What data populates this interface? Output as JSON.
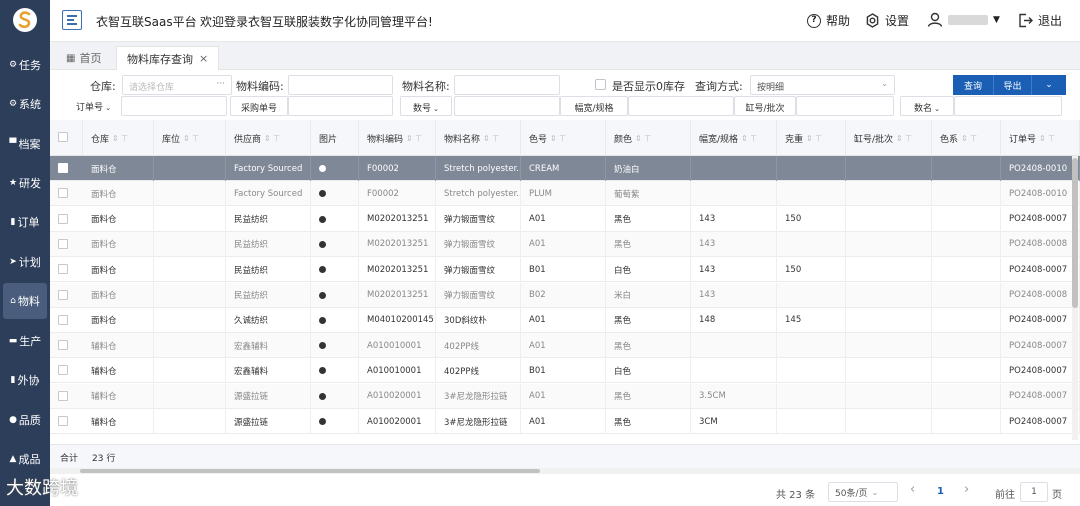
{
  "sidebar": {
    "items": [
      {
        "icon": "⚙",
        "label": "任务"
      },
      {
        "icon": "⚙",
        "label": "系统"
      },
      {
        "icon": "▀",
        "label": "档案"
      },
      {
        "icon": "★",
        "label": "研发"
      },
      {
        "icon": "▮",
        "label": "订单"
      },
      {
        "icon": "➤",
        "label": "计划"
      },
      {
        "icon": "⌂",
        "label": "物料"
      },
      {
        "icon": "▬",
        "label": "生产"
      },
      {
        "icon": "▮",
        "label": "外协"
      },
      {
        "icon": "●",
        "label": "品质"
      },
      {
        "icon": "▲",
        "label": "成品"
      }
    ]
  },
  "header": {
    "app_title": "衣智互联Saas平台",
    "welcome": "欢迎登录衣智互联服装数字化协同管理平台!",
    "help": "帮助",
    "settings": "设置",
    "logout": "退出"
  },
  "tabs": {
    "home": "首页",
    "active": "物料库存查询",
    "close": "×"
  },
  "filters": {
    "warehouse_label": "仓库:",
    "warehouse_placeholder": "请选择仓库",
    "warehouse_more": "···",
    "material_code_label": "物料编码:",
    "material_name_label": "物料名称:",
    "show_zero_label": "是否显示0库存",
    "query_mode_label": "查询方式:",
    "query_mode_value": "按明细",
    "query_button": "查询",
    "export_button": "导出",
    "order_no": "订单号",
    "purchase_no": "采购单号",
    "quantity": "数号",
    "width_spec": "幅宽/规格",
    "vat_batch": "缸号/批次",
    "count": "数名"
  },
  "table": {
    "headers": [
      "仓库",
      "库位",
      "供应商",
      "图片",
      "物料编码",
      "物料名称",
      "色号",
      "颜色",
      "幅宽/规格",
      "克重",
      "缸号/批次",
      "色系",
      "订单号"
    ],
    "rows": [
      [
        "面料仓",
        "",
        "Factory Sourced",
        "",
        "F00002",
        "Stretch polyester...",
        "CREAM",
        "奶油白",
        "",
        "",
        "",
        "",
        "PO2408-0010"
      ],
      [
        "面料仓",
        "",
        "Factory Sourced",
        "",
        "F00002",
        "Stretch polyester...",
        "PLUM",
        "葡萄紫",
        "",
        "",
        "",
        "",
        "PO2408-0010"
      ],
      [
        "面料仓",
        "",
        "民益纺织",
        "",
        "M0202013251",
        "弹力锻面雪纹",
        "A01",
        "黑色",
        "143",
        "150",
        "",
        "",
        "PO2408-0007"
      ],
      [
        "面料仓",
        "",
        "民益纺织",
        "",
        "M0202013251",
        "弹力锻面雪纹",
        "A01",
        "黑色",
        "143",
        "",
        "",
        "",
        "PO2408-0008"
      ],
      [
        "面料仓",
        "",
        "民益纺织",
        "",
        "M0202013251",
        "弹力锻面雪纹",
        "B01",
        "白色",
        "143",
        "150",
        "",
        "",
        "PO2408-0007"
      ],
      [
        "面料仓",
        "",
        "民益纺织",
        "",
        "M0202013251",
        "弹力锻面雪纹",
        "B02",
        "米白",
        "143",
        "",
        "",
        "",
        "PO2408-0008"
      ],
      [
        "面料仓",
        "",
        "久诚纺织",
        "",
        "M04010200145",
        "30D斜纹朴",
        "A01",
        "黑色",
        "148",
        "145",
        "",
        "",
        "PO2408-0007"
      ],
      [
        "辅料仓",
        "",
        "宏鑫辅料",
        "",
        "A010010001",
        "402PP线",
        "A01",
        "黑色",
        "",
        "",
        "",
        "",
        "PO2408-0007"
      ],
      [
        "辅料仓",
        "",
        "宏鑫辅料",
        "",
        "A010010001",
        "402PP线",
        "B01",
        "白色",
        "",
        "",
        "",
        "",
        "PO2408-0007"
      ],
      [
        "辅料仓",
        "",
        "源盛拉链",
        "",
        "A010020001",
        "3#尼龙隐形拉链",
        "A01",
        "黑色",
        "3.5CM",
        "",
        "",
        "",
        "PO2408-0007"
      ],
      [
        "辅料仓",
        "",
        "源盛拉链",
        "",
        "A010020001",
        "3#尼龙隐形拉链",
        "A01",
        "黑色",
        "3CM",
        "",
        "",
        "",
        "PO2408-0007"
      ]
    ]
  },
  "summary": {
    "total_label": "合计",
    "rows_count": "23 行"
  },
  "pager": {
    "total": "共 23 条",
    "page_size": "50条/页",
    "prev": "‹",
    "current": "1",
    "next": "›",
    "goto_label": "前往",
    "goto_value": "1",
    "page_unit": "页"
  },
  "watermark": "大数跨境"
}
